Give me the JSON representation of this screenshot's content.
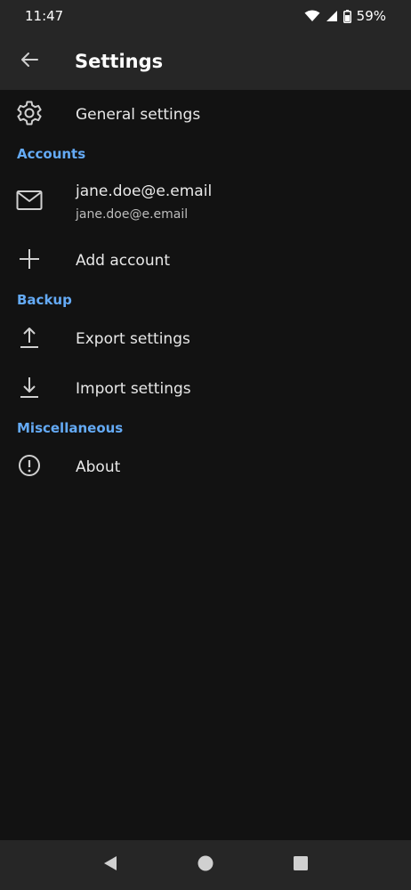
{
  "status_bar": {
    "time": "11:47",
    "battery": "59%"
  },
  "app_bar": {
    "title": "Settings",
    "back_icon": "arrow-back-icon"
  },
  "items": {
    "general": {
      "label": "General settings",
      "icon": "gear-icon"
    },
    "account": {
      "label": "jane.doe@e.email",
      "subtitle": "jane.doe@e.email",
      "icon": "mail-icon"
    },
    "add_account": {
      "label": "Add account",
      "icon": "plus-icon"
    },
    "export": {
      "label": "Export settings",
      "icon": "upload-icon"
    },
    "import": {
      "label": "Import settings",
      "icon": "download-icon"
    },
    "about": {
      "label": "About",
      "icon": "info-icon"
    }
  },
  "sections": {
    "accounts": "Accounts",
    "backup": "Backup",
    "misc": "Miscellaneous"
  },
  "colors": {
    "background": "#121212",
    "bar": "#262626",
    "accent": "#64aaf5",
    "text": "#e8e8e8"
  }
}
